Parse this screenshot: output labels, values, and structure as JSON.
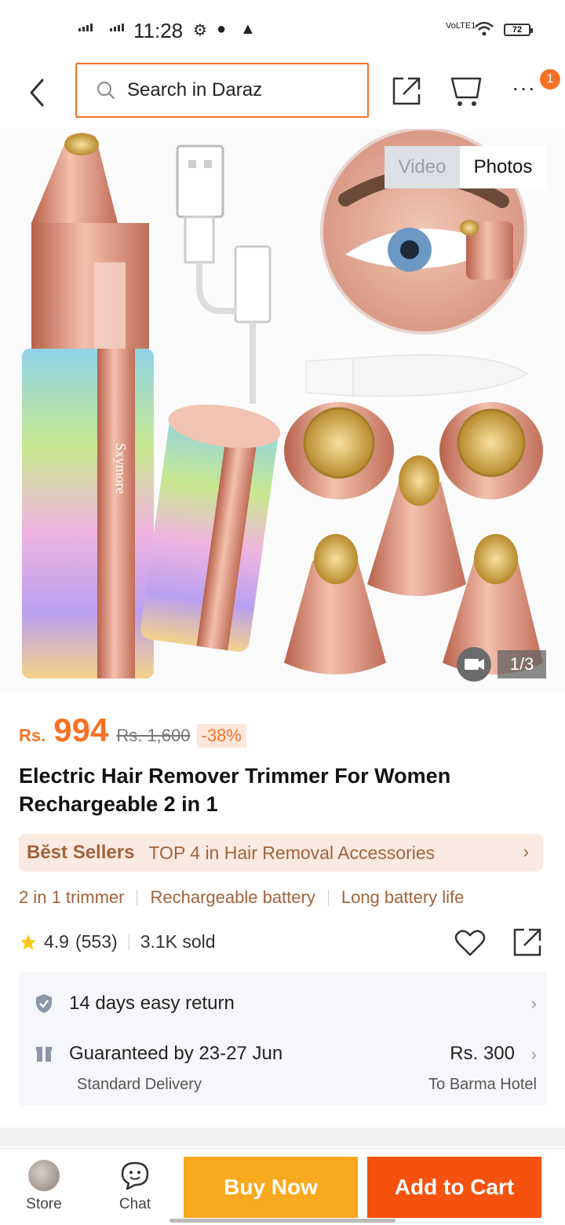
{
  "status_bar": {
    "time": "11:28",
    "battery": "72",
    "network_label": "VoLTE1"
  },
  "header": {
    "search_placeholder": "Search in Daraz",
    "notification_count": "1"
  },
  "gallery": {
    "tabs": [
      "Video",
      "Photos"
    ],
    "active_tab": "Photos",
    "counter": "1/3",
    "brand_text": "Sxymore"
  },
  "product": {
    "currency": "Rs.",
    "price": "994",
    "old_price": "Rs. 1,600",
    "discount": "-38%",
    "title": "Electric Hair Remover Trimmer For Women Rechargeable 2 in 1",
    "best_sellers_logo": "Bĕst Sellers",
    "best_sellers_text": "TOP 4 in Hair Removal Accessories",
    "features": [
      "2 in 1 trimmer",
      "Rechargeable battery",
      "Long battery life"
    ],
    "rating": "4.9",
    "rating_count": "(553)",
    "sold": "3.1K sold"
  },
  "service": {
    "return_text": "14 days easy return",
    "delivery_text": "Guaranteed by 23-27 Jun",
    "delivery_type": "Standard Delivery",
    "delivery_price": "Rs. 300",
    "destination": "To Barma Hotel"
  },
  "bottom_bar": {
    "store_label": "Store",
    "chat_label": "Chat",
    "buy_now": "Buy Now",
    "add_to_cart": "Add to Cart"
  },
  "colors": {
    "accent": "#f57224",
    "buy_now": "#f8a91d",
    "add_to_cart": "#f5520f",
    "bestseller_text": "#a0633d"
  }
}
